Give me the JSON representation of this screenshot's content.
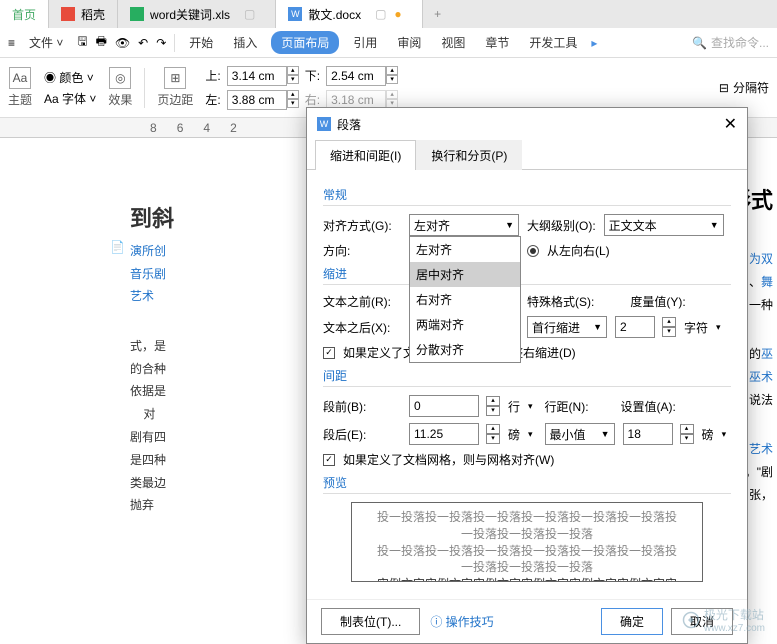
{
  "tabs": {
    "home": "首页",
    "t1": "稻壳",
    "t2": "word关键词.xls",
    "t3": "散文.docx",
    "add": "+"
  },
  "toolbar": {
    "file": "文件",
    "menus": [
      "开始",
      "插入",
      "页面布局",
      "引用",
      "审阅",
      "视图",
      "章节",
      "开发工具"
    ],
    "search_placeholder": "查找命令..."
  },
  "ribbon": {
    "theme": "主题",
    "color": "颜色",
    "font": "字体",
    "effect": "效果",
    "page_margin": "页边距",
    "top_label": "上:",
    "bottom_label": "下:",
    "left_label": "左:",
    "right_label": "右:",
    "top_val": "3.14 cm",
    "bottom_val": "2.54 cm",
    "left_val": "3.88 cm",
    "right_val": "3.18 cm",
    "separator": "分隔符"
  },
  "ruler": [
    "8",
    "6",
    "4",
    "2"
  ],
  "doc": {
    "h1": "到斜",
    "p1a": "演所创",
    "p2a": "音乐剧",
    "p3a": "艺术",
    "p4": "式，是",
    "p5": "的合种",
    "p6": "依据是",
    "p7": "对",
    "p8": "剧有四",
    "p9": "是四种",
    "p10": "类最边",
    "p11": "抛弃",
    "r1": "形式",
    "r2": "为双",
    "r3": "、舞",
    "r4": "一种",
    "r5": "的巫",
    "r6": "巫术",
    "r7": "说法",
    "r8": "艺术",
    "r9": "。\"剧",
    "r10": "张，"
  },
  "dialog": {
    "title": "段落",
    "tab1": "缩进和间距(I)",
    "tab2": "换行和分页(P)",
    "sec_general": "常规",
    "align_label": "对齐方式(G):",
    "align_value": "左对齐",
    "align_options": [
      "左对齐",
      "居中对齐",
      "右对齐",
      "两端对齐",
      "分散对齐"
    ],
    "outline_label": "大纲级别(O):",
    "outline_value": "正文文本",
    "direction_label": "方向:",
    "direction_ltr": "从左向右(L)",
    "sec_indent": "缩进",
    "before_text": "文本之前(R):",
    "after_text": "文本之后(X):",
    "special_label": "特殊格式(S):",
    "special_value": "首行缩进",
    "measure_label": "度量值(Y):",
    "measure_value": "2",
    "measure_unit": "字符",
    "auto_indent": "如果定义了文档网格，则自动调整右缩进(D)",
    "sec_spacing": "间距",
    "before_para": "段前(B):",
    "before_para_val": "0",
    "before_para_unit": "行",
    "after_para": "段后(E):",
    "after_para_val": "11.25",
    "after_para_unit": "磅",
    "line_spacing": "行距(N):",
    "line_spacing_val": "最小值",
    "set_value": "设置值(A):",
    "set_value_val": "18",
    "set_value_unit": "磅",
    "grid_align": "如果定义了文档网格，则与网格对齐(W)",
    "sec_preview": "预览",
    "preview_text1": "投一投落投一投落投一投落投一投落投一投落投一投落投一投落投一投落投一投落",
    "preview_text2": "实例文字实例文字实例文字实例文字实例文字实例文字实例文字实例文字实例文字实例",
    "tabstops": "制表位(T)...",
    "tips": "操作技巧",
    "ok": "确定",
    "cancel": "取消"
  },
  "watermark": {
    "text": "极光下载站",
    "url": "www.xz7.com"
  }
}
